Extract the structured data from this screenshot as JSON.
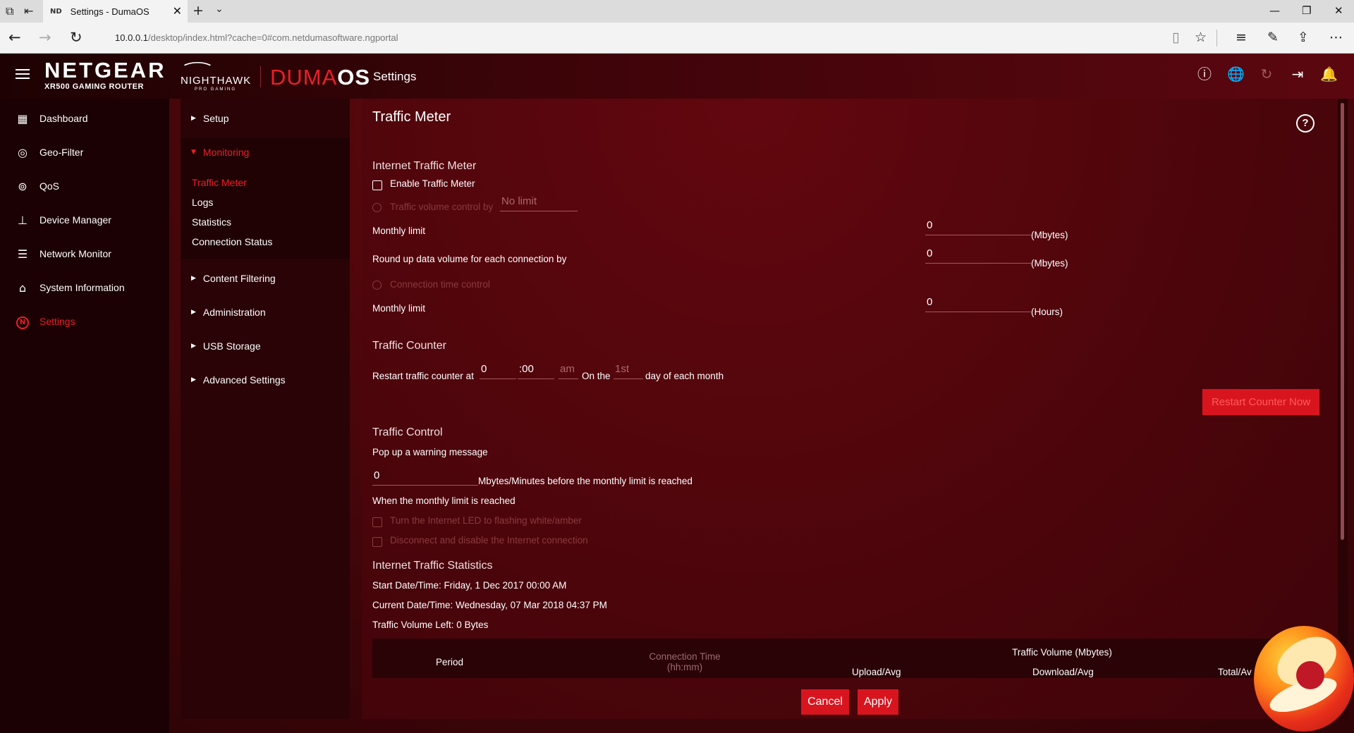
{
  "browser": {
    "tab_icon": "ND",
    "tab_title": "Settings - DumaOS",
    "url_host": "10.0.0.1",
    "url_rest": "/desktop/index.html?cache=0#com.netdumasoftware.ngportal"
  },
  "header": {
    "brand": "NETGEAR",
    "brand_sub": "XR500 GAMING ROUTER",
    "hawk_name": "NIGHTHAWK",
    "hawk_sub": "PRO GAMING",
    "duma": "DUMA",
    "duma_os": "OS",
    "title": "Settings",
    "icons": [
      "info-icon",
      "globe-icon",
      "refresh-icon",
      "logout-icon",
      "bell-icon"
    ]
  },
  "sidebar": {
    "items": [
      {
        "label": "Dashboard",
        "icon": "dashboard-icon"
      },
      {
        "label": "Geo-Filter",
        "icon": "geo-filter-icon"
      },
      {
        "label": "QoS",
        "icon": "qos-icon"
      },
      {
        "label": "Device Manager",
        "icon": "device-manager-icon"
      },
      {
        "label": "Network Monitor",
        "icon": "network-monitor-icon"
      },
      {
        "label": "System Information",
        "icon": "system-information-icon"
      },
      {
        "label": "Settings",
        "icon": "settings-n-icon"
      }
    ]
  },
  "submenu": {
    "setup": "Setup",
    "monitoring": "Monitoring",
    "monitoring_items": [
      "Traffic Meter",
      "Logs",
      "Statistics",
      "Connection Status"
    ],
    "content_filtering": "Content Filtering",
    "administration": "Administration",
    "usb_storage": "USB Storage",
    "advanced_settings": "Advanced Settings"
  },
  "main": {
    "title": "Traffic Meter",
    "itm_heading": "Internet Traffic Meter",
    "enable_label": "Enable Traffic Meter",
    "volume_control_label": "Traffic volume control by",
    "volume_control_value": "No limit",
    "monthly_limit_label": "Monthly limit",
    "monthly_limit_value": "0",
    "mbytes_unit": "(Mbytes)",
    "roundup_label": "Round up data volume for each connection by",
    "roundup_value": "0",
    "conn_time_label": "Connection time control",
    "monthly_limit_hours_value": "0",
    "hours_unit": "(Hours)",
    "traffic_counter_heading": "Traffic Counter",
    "restart_label": "Restart traffic counter at",
    "restart_hour": "0",
    "restart_min": ":00",
    "restart_ampm": "am",
    "on_the": "On the",
    "restart_day": "1st",
    "day_suffix": "day of each month",
    "restart_button": "Restart Counter Now",
    "traffic_control_heading": "Traffic Control",
    "popup_label": "Pop up a warning message",
    "warning_value": "0",
    "warning_suffix": "Mbytes/Minutes before the monthly limit is reached",
    "when_reached": "When the monthly limit is reached",
    "led_label": "Turn the Internet LED to flashing white/amber",
    "disconnect_label": "Disconnect and disable the Internet connection",
    "stats_heading": "Internet Traffic Statistics",
    "start_datetime": "Start Date/Time: Friday, 1 Dec 2017 00:00 AM",
    "current_datetime": "Current Date/Time: Wednesday, 07 Mar 2018 04:37 PM",
    "volume_left": "Traffic Volume Left: 0 Bytes",
    "table": {
      "period": "Period",
      "connection_time": "Connection Time",
      "conn_time_unit": "(hh:mm)",
      "traffic_volume": "Traffic Volume (Mbytes)",
      "upload": "Upload/Avg",
      "download": "Download/Avg",
      "total": "Total/Av"
    },
    "cancel": "Cancel",
    "apply": "Apply"
  }
}
